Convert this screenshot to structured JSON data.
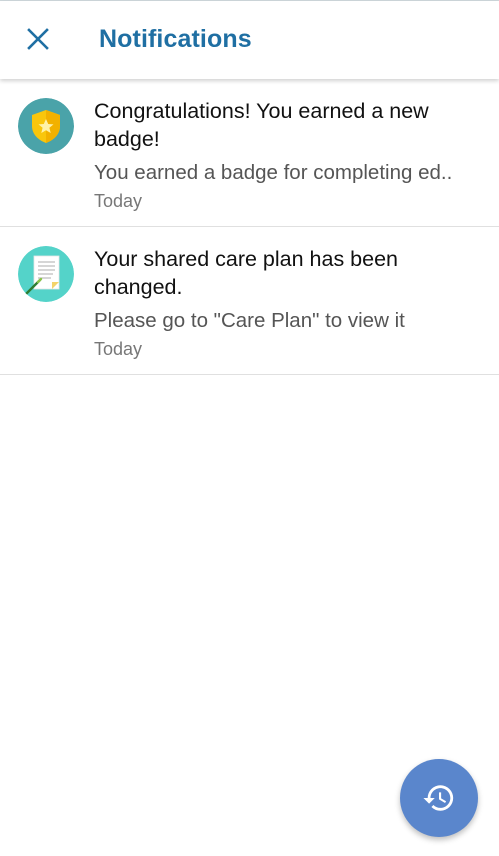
{
  "header": {
    "title": "Notifications",
    "close_icon": "close-icon"
  },
  "notifications": [
    {
      "icon": "shield-badge-icon",
      "title": "Congratulations! You earned a new badge!",
      "body": "You earned a badge for completing ed..",
      "time": "Today"
    },
    {
      "icon": "care-plan-document-icon",
      "title": "Your shared care plan has been changed.",
      "body": "Please go to \"Care Plan\" to view it",
      "time": "Today"
    }
  ],
  "fab": {
    "icon": "history-icon"
  },
  "colors": {
    "title_blue": "#1f6fa3",
    "fab_blue": "#5a86cc",
    "badge_teal": "#4aa3a9",
    "careplan_teal": "#54d3c9"
  }
}
